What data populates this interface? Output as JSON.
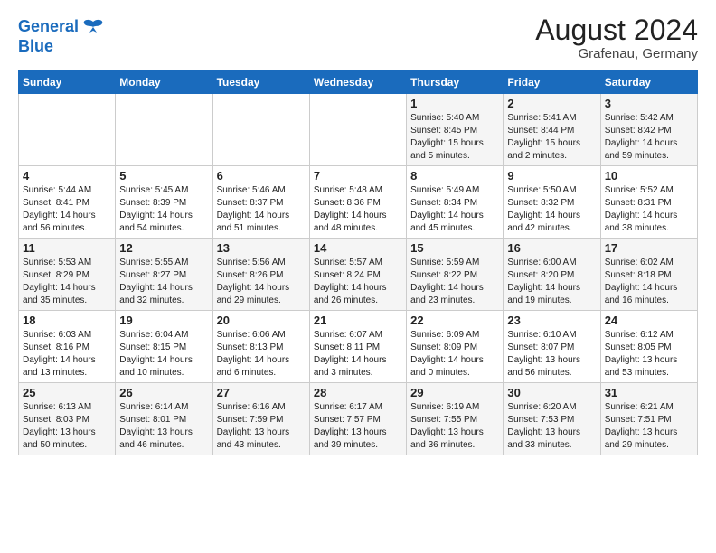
{
  "header": {
    "logo_line1": "General",
    "logo_line2": "Blue",
    "month_year": "August 2024",
    "location": "Grafenau, Germany"
  },
  "weekdays": [
    "Sunday",
    "Monday",
    "Tuesday",
    "Wednesday",
    "Thursday",
    "Friday",
    "Saturday"
  ],
  "weeks": [
    [
      {
        "day": "",
        "info": ""
      },
      {
        "day": "",
        "info": ""
      },
      {
        "day": "",
        "info": ""
      },
      {
        "day": "",
        "info": ""
      },
      {
        "day": "1",
        "info": "Sunrise: 5:40 AM\nSunset: 8:45 PM\nDaylight: 15 hours\nand 5 minutes."
      },
      {
        "day": "2",
        "info": "Sunrise: 5:41 AM\nSunset: 8:44 PM\nDaylight: 15 hours\nand 2 minutes."
      },
      {
        "day": "3",
        "info": "Sunrise: 5:42 AM\nSunset: 8:42 PM\nDaylight: 14 hours\nand 59 minutes."
      }
    ],
    [
      {
        "day": "4",
        "info": "Sunrise: 5:44 AM\nSunset: 8:41 PM\nDaylight: 14 hours\nand 56 minutes."
      },
      {
        "day": "5",
        "info": "Sunrise: 5:45 AM\nSunset: 8:39 PM\nDaylight: 14 hours\nand 54 minutes."
      },
      {
        "day": "6",
        "info": "Sunrise: 5:46 AM\nSunset: 8:37 PM\nDaylight: 14 hours\nand 51 minutes."
      },
      {
        "day": "7",
        "info": "Sunrise: 5:48 AM\nSunset: 8:36 PM\nDaylight: 14 hours\nand 48 minutes."
      },
      {
        "day": "8",
        "info": "Sunrise: 5:49 AM\nSunset: 8:34 PM\nDaylight: 14 hours\nand 45 minutes."
      },
      {
        "day": "9",
        "info": "Sunrise: 5:50 AM\nSunset: 8:32 PM\nDaylight: 14 hours\nand 42 minutes."
      },
      {
        "day": "10",
        "info": "Sunrise: 5:52 AM\nSunset: 8:31 PM\nDaylight: 14 hours\nand 38 minutes."
      }
    ],
    [
      {
        "day": "11",
        "info": "Sunrise: 5:53 AM\nSunset: 8:29 PM\nDaylight: 14 hours\nand 35 minutes."
      },
      {
        "day": "12",
        "info": "Sunrise: 5:55 AM\nSunset: 8:27 PM\nDaylight: 14 hours\nand 32 minutes."
      },
      {
        "day": "13",
        "info": "Sunrise: 5:56 AM\nSunset: 8:26 PM\nDaylight: 14 hours\nand 29 minutes."
      },
      {
        "day": "14",
        "info": "Sunrise: 5:57 AM\nSunset: 8:24 PM\nDaylight: 14 hours\nand 26 minutes."
      },
      {
        "day": "15",
        "info": "Sunrise: 5:59 AM\nSunset: 8:22 PM\nDaylight: 14 hours\nand 23 minutes."
      },
      {
        "day": "16",
        "info": "Sunrise: 6:00 AM\nSunset: 8:20 PM\nDaylight: 14 hours\nand 19 minutes."
      },
      {
        "day": "17",
        "info": "Sunrise: 6:02 AM\nSunset: 8:18 PM\nDaylight: 14 hours\nand 16 minutes."
      }
    ],
    [
      {
        "day": "18",
        "info": "Sunrise: 6:03 AM\nSunset: 8:16 PM\nDaylight: 14 hours\nand 13 minutes."
      },
      {
        "day": "19",
        "info": "Sunrise: 6:04 AM\nSunset: 8:15 PM\nDaylight: 14 hours\nand 10 minutes."
      },
      {
        "day": "20",
        "info": "Sunrise: 6:06 AM\nSunset: 8:13 PM\nDaylight: 14 hours\nand 6 minutes."
      },
      {
        "day": "21",
        "info": "Sunrise: 6:07 AM\nSunset: 8:11 PM\nDaylight: 14 hours\nand 3 minutes."
      },
      {
        "day": "22",
        "info": "Sunrise: 6:09 AM\nSunset: 8:09 PM\nDaylight: 14 hours\nand 0 minutes."
      },
      {
        "day": "23",
        "info": "Sunrise: 6:10 AM\nSunset: 8:07 PM\nDaylight: 13 hours\nand 56 minutes."
      },
      {
        "day": "24",
        "info": "Sunrise: 6:12 AM\nSunset: 8:05 PM\nDaylight: 13 hours\nand 53 minutes."
      }
    ],
    [
      {
        "day": "25",
        "info": "Sunrise: 6:13 AM\nSunset: 8:03 PM\nDaylight: 13 hours\nand 50 minutes."
      },
      {
        "day": "26",
        "info": "Sunrise: 6:14 AM\nSunset: 8:01 PM\nDaylight: 13 hours\nand 46 minutes."
      },
      {
        "day": "27",
        "info": "Sunrise: 6:16 AM\nSunset: 7:59 PM\nDaylight: 13 hours\nand 43 minutes."
      },
      {
        "day": "28",
        "info": "Sunrise: 6:17 AM\nSunset: 7:57 PM\nDaylight: 13 hours\nand 39 minutes."
      },
      {
        "day": "29",
        "info": "Sunrise: 6:19 AM\nSunset: 7:55 PM\nDaylight: 13 hours\nand 36 minutes."
      },
      {
        "day": "30",
        "info": "Sunrise: 6:20 AM\nSunset: 7:53 PM\nDaylight: 13 hours\nand 33 minutes."
      },
      {
        "day": "31",
        "info": "Sunrise: 6:21 AM\nSunset: 7:51 PM\nDaylight: 13 hours\nand 29 minutes."
      }
    ]
  ]
}
